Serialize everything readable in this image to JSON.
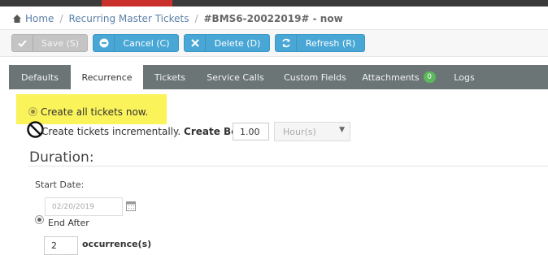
{
  "breadcrumb": {
    "home": "Home",
    "section": "Recurring Master Tickets",
    "current": "#BMS6-20022019# - now"
  },
  "toolbar": {
    "save_label": "Save (S)",
    "cancel_label": "Cancel (C)",
    "delete_label": "Delete (D)",
    "refresh_label": "Refresh (R)"
  },
  "tabs": [
    {
      "label": "Defaults"
    },
    {
      "label": "Recurrence"
    },
    {
      "label": "Tickets"
    },
    {
      "label": "Service Calls"
    },
    {
      "label": "Custom Fields"
    },
    {
      "label": "Attachments",
      "badge": "0"
    },
    {
      "label": "Logs"
    }
  ],
  "recurrence": {
    "create_all_label": "Create all tickets now.",
    "create_inc_label": "Create tickets incrementally.",
    "create_before_label": "Create Before:",
    "create_before_value": "1.00",
    "unit_selected": "Hour(s)"
  },
  "duration": {
    "heading": "Duration:",
    "start_date_label": "Start Date:",
    "start_date_placeholder": "02/20/2019",
    "end_after_label": "End After",
    "occurrences_value": "2",
    "occurrences_label": "occurrence(s)"
  },
  "colors": {
    "primary_button": "#49a7d6",
    "disabled_button": "#c4c4c4",
    "tab_bar": "#6b7576",
    "highlight": "#fbf35a",
    "badge": "#5cb85c"
  }
}
